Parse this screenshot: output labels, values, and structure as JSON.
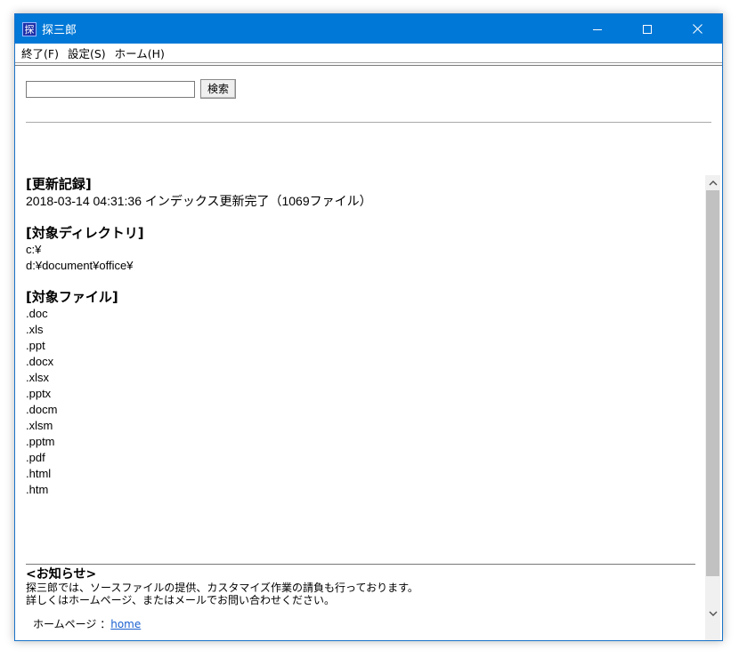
{
  "window": {
    "title": "探三郎",
    "icon_glyph": "探",
    "titlebar_color": "#0078d7"
  },
  "menu": {
    "items": [
      "終了(F)",
      "設定(S)",
      "ホーム(H)"
    ]
  },
  "search": {
    "value": "",
    "button_label": "検索"
  },
  "update": {
    "heading": "[更新記録]",
    "line": "2018-03-14 04:31:36 インデックス更新完了（1069ファイル）"
  },
  "directories": {
    "heading": "[対象ディレクトリ]",
    "items": [
      "c:¥",
      "d:¥document¥office¥"
    ]
  },
  "files": {
    "heading": "[対象ファイル]",
    "items": [
      ".doc",
      ".xls",
      ".ppt",
      ".docx",
      ".xlsx",
      ".pptx",
      ".docm",
      ".xlsm",
      ".pptm",
      ".pdf",
      ".html",
      ".htm"
    ]
  },
  "notice": {
    "heading": "<お知らせ>",
    "lines": [
      "探三郎では、ソースファイルの提供、カスタマイズ作業の請負も行っております。",
      "詳しくはホームページ、またはメールでお問い合わせください。"
    ],
    "homepage_label": "ホームページ ：",
    "homepage_link": "home"
  }
}
